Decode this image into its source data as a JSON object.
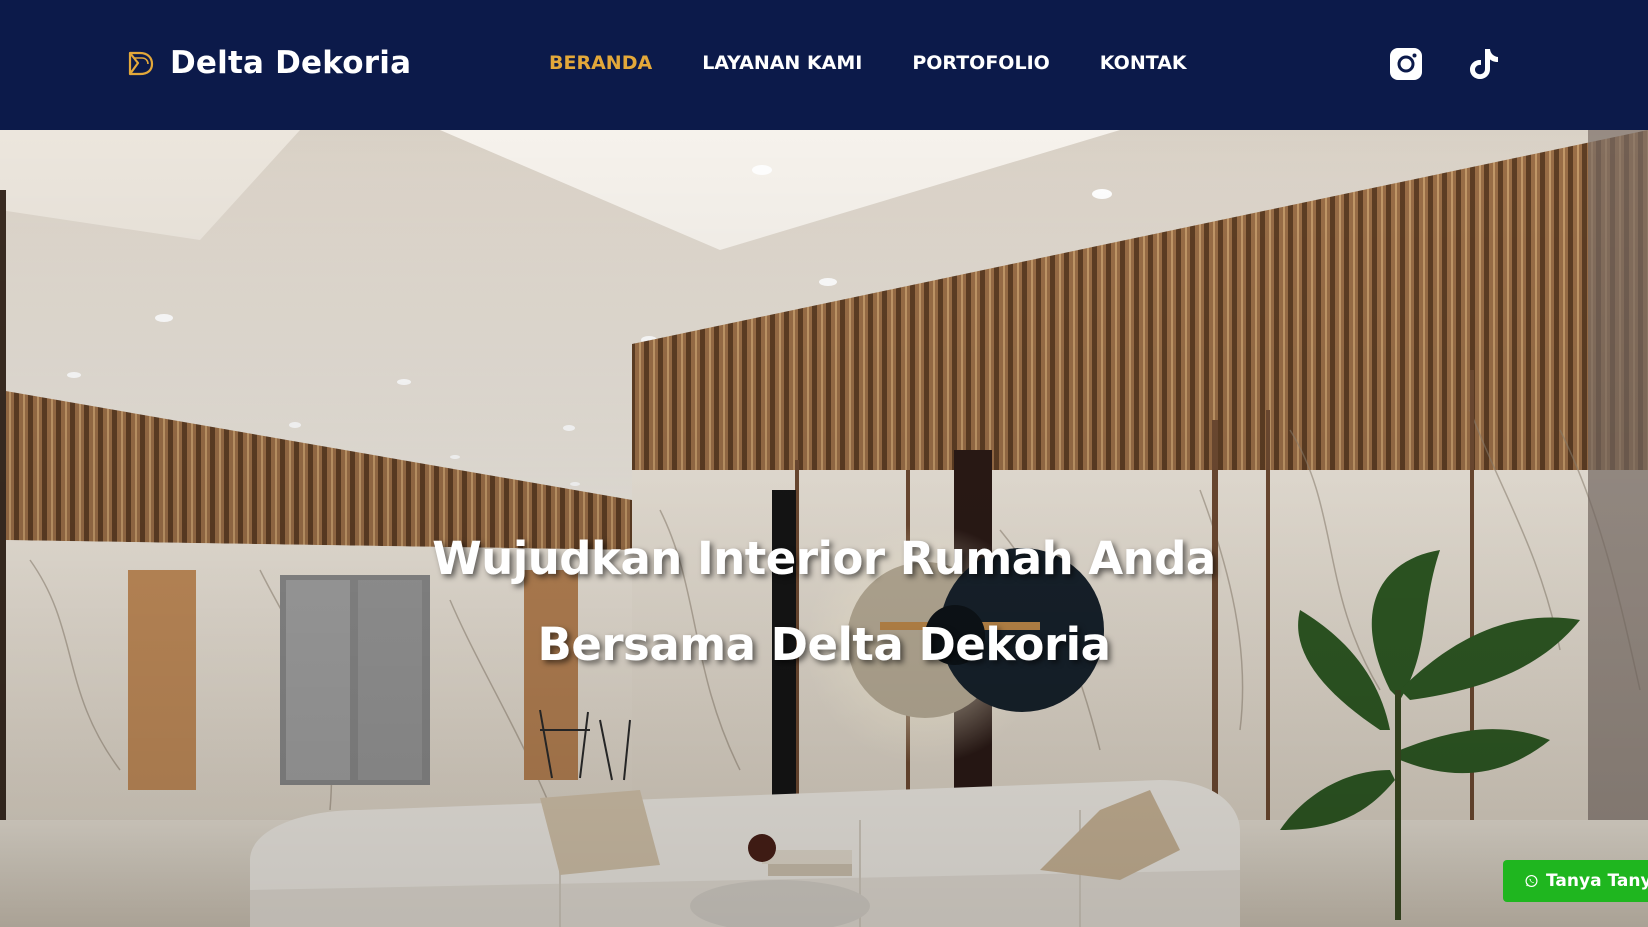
{
  "brand": {
    "name": "Delta Dekoria",
    "logo_icon": "delta-d-logo-icon"
  },
  "nav": {
    "items": [
      {
        "label": "BERANDA",
        "active": true
      },
      {
        "label": "LAYANAN KAMI",
        "active": false
      },
      {
        "label": "PORTOFOLIO",
        "active": false
      },
      {
        "label": "KONTAK",
        "active": false
      }
    ]
  },
  "social": {
    "icons": [
      "instagram-icon",
      "tiktok-icon"
    ]
  },
  "hero": {
    "title_line1": "Wujudkan Interior Rumah Anda",
    "title_line2": "Bersama Delta Dekoria"
  },
  "chat_button": {
    "label": "Tanya Tanya",
    "icon": "whatsapp-icon"
  },
  "colors": {
    "navbar_bg": "#0c1a4a",
    "accent": "#e3a83a",
    "chat_green": "#1fb61f",
    "text_white": "#ffffff"
  }
}
